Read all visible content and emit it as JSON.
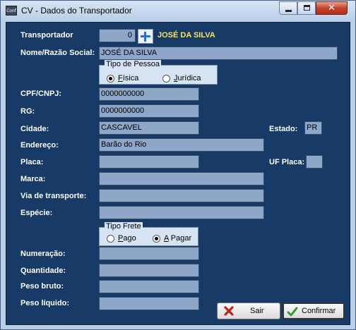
{
  "window": {
    "title": "CV - Dados do Transportador",
    "app_icon_text": "Conf"
  },
  "header": {
    "transportador_label": "Transportador",
    "transportador_code": "0",
    "transportador_name": "JOSÉ DA SILVA"
  },
  "form": {
    "nome_label": "Nome/Razão Social:",
    "nome_value": "JOSÉ DA SILVA",
    "tipo_pessoa": {
      "title": "Tipo de Pessoa",
      "options": [
        "Física",
        "Jurídica"
      ],
      "selected": "Física"
    },
    "cpf_label": "CPF/CNPJ:",
    "cpf_value": "0000000000",
    "rg_label": "RG:",
    "rg_value": "0000000000",
    "cidade_label": "Cidade:",
    "cidade_value": "CASCAVEL",
    "estado_label": "Estado:",
    "estado_value": "PR",
    "endereco_label": "Endereço:",
    "endereco_value": "Barão do Rio",
    "placa_label": "Placa:",
    "placa_value": "",
    "uf_placa_label": "UF Placa:",
    "uf_placa_value": "",
    "marca_label": "Marca:",
    "marca_value": "",
    "via_label": "Via de transporte:",
    "via_value": "",
    "especie_label": "Espécie:",
    "especie_value": "",
    "tipo_frete": {
      "title": "Tipo Frete",
      "options": [
        "Pago",
        "A Pagar"
      ],
      "selected": "A Pagar"
    },
    "numeracao_label": "Numeração:",
    "numeracao_value": "",
    "quantidade_label": "Quantidade:",
    "quantidade_value": "",
    "peso_bruto_label": "Peso bruto:",
    "peso_bruto_value": "",
    "peso_liquido_label": "Peso líquido:",
    "peso_liquido_value": ""
  },
  "buttons": {
    "sair": "Sair",
    "confirmar": "Confirmar"
  },
  "icons": {
    "plus": "plus-icon",
    "sair": "x-icon",
    "confirmar": "checkmark-icon"
  },
  "colors": {
    "panel": "#183a66",
    "field": "#8ea7c9",
    "highlight_text": "#f5e36a"
  }
}
